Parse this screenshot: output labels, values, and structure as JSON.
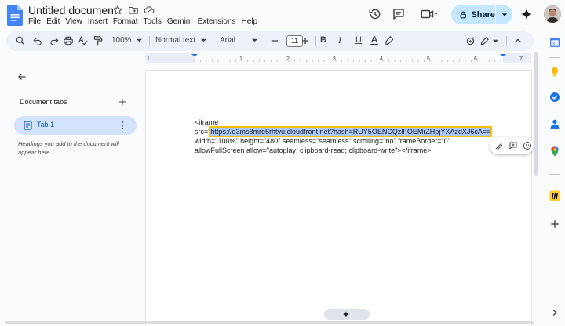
{
  "doc": {
    "title": "Untitled document"
  },
  "menu": [
    "File",
    "Edit",
    "View",
    "Insert",
    "Format",
    "Tools",
    "Gemini",
    "Extensions",
    "Help"
  ],
  "share": {
    "label": "Share"
  },
  "toolbar": {
    "zoom": "100%",
    "style": "Normal text",
    "font": "Arial",
    "font_size": "11",
    "bold": "B",
    "italic": "I",
    "underline": "U"
  },
  "ruler": {
    "numbers": [
      "1",
      "1",
      "2",
      "3",
      "4",
      "5",
      "6",
      "7"
    ]
  },
  "sidebar": {
    "heading": "Document tabs",
    "tab": {
      "label": "Tab 1"
    },
    "hint": "Headings you add to the document will appear here."
  },
  "content": {
    "line1": "<iframe",
    "line2_prefix": "src=\"",
    "url": "https://d3ms8mre5rhtvu.cloudfront.net?hash=RUY5OENCQzlFOEMrZHpjYXAzdXJ6cA==",
    "line3": "width=\"100%\" height=\"480\" seamless=\"seamless\" scrolling=\"no\" frameBorder=\"0\"",
    "line4": "allowFullScreen allow=\"autoplay; clipboard-read; clipboard-write\"></iframe>"
  },
  "colors": {
    "accent": "#0b57d0",
    "share_bg": "#c2e7ff",
    "tab_bg": "#d3e3fd",
    "highlight": "#a8c7fa",
    "highlight_border": "#fbbc04"
  }
}
